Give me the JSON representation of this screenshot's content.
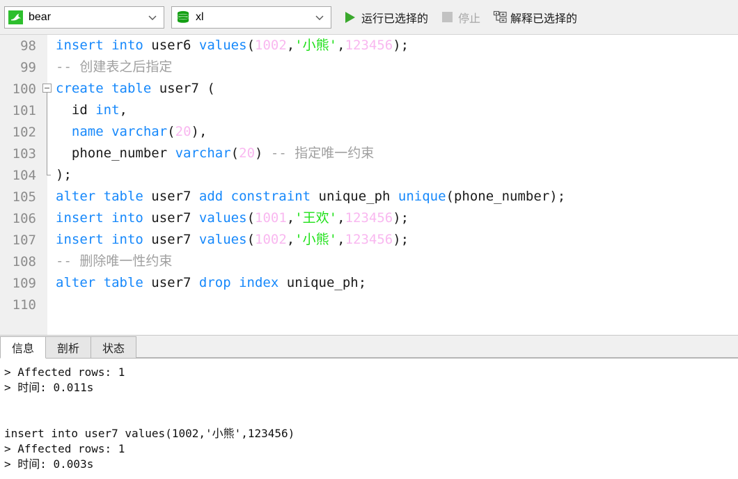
{
  "toolbar": {
    "connection": {
      "icon": "mysql-dolphin-icon",
      "value": "bear"
    },
    "schema": {
      "icon": "database-icon",
      "value": "xl"
    },
    "run_selected": {
      "icon": "play-icon",
      "label": "运行已选择的"
    },
    "stop": {
      "icon": "stop-icon",
      "label": "停止"
    },
    "explain_selected": {
      "icon": "explain-plan-icon",
      "label": "解释已选择的"
    }
  },
  "editor": {
    "lines": [
      {
        "no": "98",
        "fold": "none",
        "selected": false,
        "tokens": [
          {
            "t": "insert into ",
            "c": "kw"
          },
          {
            "t": "user6 ",
            "c": "pl"
          },
          {
            "t": "values",
            "c": "kw"
          },
          {
            "t": "(",
            "c": "pl"
          },
          {
            "t": "1002",
            "c": "num"
          },
          {
            "t": ",",
            "c": "pl"
          },
          {
            "t": "'小熊'",
            "c": "str"
          },
          {
            "t": ",",
            "c": "pl"
          },
          {
            "t": "123456",
            "c": "num"
          },
          {
            "t": ");",
            "c": "pl"
          }
        ]
      },
      {
        "no": "99",
        "fold": "none",
        "selected": false,
        "tokens": [
          {
            "t": "-- 创建表之后指定",
            "c": "cmt"
          }
        ]
      },
      {
        "no": "100",
        "fold": "start",
        "selected": false,
        "tokens": [
          {
            "t": "create table ",
            "c": "kw"
          },
          {
            "t": "user7 (",
            "c": "pl"
          }
        ]
      },
      {
        "no": "101",
        "fold": "mid",
        "selected": false,
        "tokens": [
          {
            "t": "  id ",
            "c": "pl"
          },
          {
            "t": "int",
            "c": "kw"
          },
          {
            "t": ",",
            "c": "pl"
          }
        ]
      },
      {
        "no": "102",
        "fold": "mid",
        "selected": false,
        "tokens": [
          {
            "t": "  ",
            "c": "pl"
          },
          {
            "t": "name varchar",
            "c": "kw"
          },
          {
            "t": "(",
            "c": "pl"
          },
          {
            "t": "20",
            "c": "num"
          },
          {
            "t": "),",
            "c": "pl"
          }
        ]
      },
      {
        "no": "103",
        "fold": "mid",
        "selected": false,
        "tokens": [
          {
            "t": "  phone_number ",
            "c": "pl"
          },
          {
            "t": "varchar",
            "c": "kw"
          },
          {
            "t": "(",
            "c": "pl"
          },
          {
            "t": "20",
            "c": "num"
          },
          {
            "t": ") ",
            "c": "pl"
          },
          {
            "t": "-- 指定唯一约束",
            "c": "cmt"
          }
        ]
      },
      {
        "no": "104",
        "fold": "end",
        "selected": false,
        "tokens": [
          {
            "t": ");",
            "c": "pl"
          }
        ]
      },
      {
        "no": "105",
        "fold": "none",
        "selected": false,
        "tokens": [
          {
            "t": "alter table ",
            "c": "kw"
          },
          {
            "t": "user7 ",
            "c": "pl"
          },
          {
            "t": "add constraint ",
            "c": "kw"
          },
          {
            "t": "unique_ph ",
            "c": "pl"
          },
          {
            "t": "unique",
            "c": "kw"
          },
          {
            "t": "(phone_number);",
            "c": "pl"
          }
        ]
      },
      {
        "no": "106",
        "fold": "none",
        "selected": true,
        "sel_width": 688,
        "tokens": [
          {
            "t": "insert into ",
            "c": "kw"
          },
          {
            "t": "user7 ",
            "c": "pl"
          },
          {
            "t": "values",
            "c": "kw"
          },
          {
            "t": "(",
            "c": "pl"
          },
          {
            "t": "1001",
            "c": "num"
          },
          {
            "t": ",",
            "c": "pl"
          },
          {
            "t": "'王欢'",
            "c": "str"
          },
          {
            "t": ",",
            "c": "pl"
          },
          {
            "t": "123456",
            "c": "num"
          },
          {
            "t": ");",
            "c": "pl"
          }
        ]
      },
      {
        "no": "107",
        "fold": "none",
        "selected": true,
        "sel_width": 675,
        "tokens": [
          {
            "t": "insert into ",
            "c": "kw"
          },
          {
            "t": "user7 ",
            "c": "pl"
          },
          {
            "t": "values",
            "c": "kw"
          },
          {
            "t": "(",
            "c": "pl"
          },
          {
            "t": "1002",
            "c": "num"
          },
          {
            "t": ",",
            "c": "pl"
          },
          {
            "t": "'小熊'",
            "c": "str"
          },
          {
            "t": ",",
            "c": "pl"
          },
          {
            "t": "123456",
            "c": "num"
          },
          {
            "t": ");",
            "c": "pl"
          }
        ]
      },
      {
        "no": "108",
        "fold": "none",
        "selected": false,
        "tokens": [
          {
            "t": "-- 删除唯一性约束",
            "c": "cmt"
          }
        ]
      },
      {
        "no": "109",
        "fold": "none",
        "selected": false,
        "tokens": [
          {
            "t": "alter table ",
            "c": "kw"
          },
          {
            "t": "user7 ",
            "c": "pl"
          },
          {
            "t": "drop index ",
            "c": "kw"
          },
          {
            "t": "unique_ph;",
            "c": "pl"
          }
        ]
      },
      {
        "no": "110",
        "fold": "none",
        "selected": false,
        "tokens": []
      }
    ]
  },
  "bottom": {
    "tabs": [
      {
        "label": "信息",
        "active": true
      },
      {
        "label": "剖析",
        "active": false
      },
      {
        "label": "状态",
        "active": false
      }
    ],
    "console_lines": [
      "> Affected rows: 1",
      "> 时间: 0.011s",
      "",
      "",
      "insert into user7 values(1002,'小熊',123456)",
      "> Affected rows: 1",
      "> 时间: 0.003s"
    ]
  },
  "colors": {
    "keyword": "#1688fb",
    "number": "#f9b8f0",
    "string": "#1ee018",
    "comment": "#a0a0a0",
    "selection": "#aed3f0",
    "toolbar_bg": "#f0f0f0",
    "gutter_bg": "#f0f0f0",
    "run_green": "#3aa82d"
  }
}
